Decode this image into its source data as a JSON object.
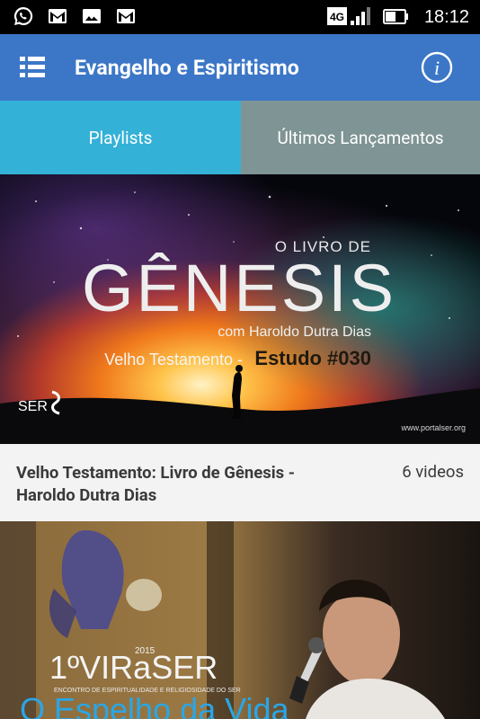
{
  "status": {
    "network": "4G",
    "time": "18:12"
  },
  "app_bar": {
    "title": "Evangelho e Espiritismo",
    "info_glyph": "i"
  },
  "tabs": [
    {
      "label": "Playlists",
      "active": true
    },
    {
      "label": "Últimos Lançamentos",
      "active": false
    }
  ],
  "playlists": [
    {
      "title": "Velho Testamento: Livro de Gênesis - Haroldo Dutra Dias",
      "count": "6 videos",
      "thumb": {
        "kicker": "O LIVRO DE",
        "headline": "GÊNESIS",
        "byline": "com Haroldo Dutra Dias",
        "subtitle_a": "Velho Testamento -",
        "subtitle_b": "Estudo #030",
        "logo": "SER",
        "url": "www.portalser.org"
      }
    },
    {
      "thumb": {
        "year": "2015",
        "brand": "1ºVIRaSER",
        "tagline": "ENCONTRO DE ESPIRITUALIDADE E RELIGIOSIDADE DO SER",
        "headline": "O Espelho da Vida"
      }
    }
  ],
  "colors": {
    "app_bar": "#3c77c7",
    "tab_active": "#34b1d6",
    "tab_inactive": "#7f9494"
  }
}
